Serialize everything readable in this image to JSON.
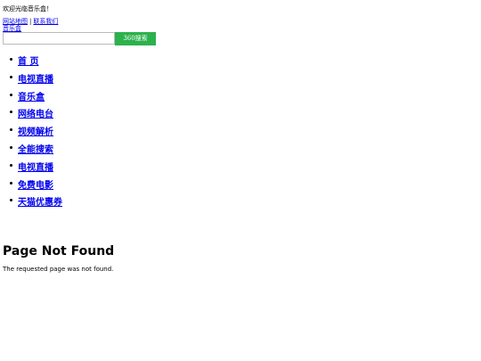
{
  "header": {
    "welcome": "欢迎光临音乐盒！",
    "links": [
      {
        "label": "网站地图"
      },
      {
        "label": "联系我们"
      }
    ],
    "separator": "|",
    "logo_alt": "音乐盒"
  },
  "search": {
    "value": "",
    "button_label": "360搜索"
  },
  "nav": [
    {
      "label": "首 页"
    },
    {
      "label": "电视直播"
    },
    {
      "label": "音乐盒"
    },
    {
      "label": "网络电台"
    },
    {
      "label": "视频解析"
    },
    {
      "label": "全能搜索"
    },
    {
      "label": "电视直播"
    },
    {
      "label": "免费电影"
    },
    {
      "label": "天猫优惠券"
    }
  ],
  "error": {
    "title": "Page Not Found",
    "message": "The requested page was not found."
  },
  "colors": {
    "link": "#0000ee",
    "search_button": "#2bb24c"
  }
}
